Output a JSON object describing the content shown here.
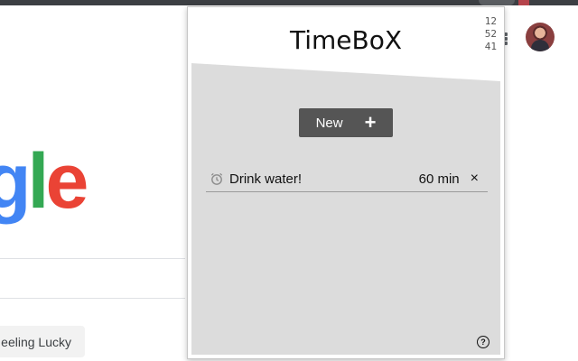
{
  "background": {
    "lucky_button_label": "eeling Lucky",
    "google_partial": {
      "g": "g",
      "l": "l",
      "e": "e"
    },
    "colors": {
      "blue": "#4285f4",
      "green": "#34a853",
      "red": "#ea4335"
    }
  },
  "popup": {
    "title": "TimeBoX",
    "clock": {
      "hours": "12",
      "minutes": "52",
      "seconds": "41"
    },
    "new_button_label": "New",
    "new_button_icon": "+",
    "tasks": [
      {
        "label": "Drink water!",
        "duration": "60 min",
        "icon": "alarm-clock-icon"
      }
    ],
    "remove_icon": "×",
    "help_icon": "?"
  },
  "colors": {
    "panel": "#dcdcdc",
    "button": "#555555"
  }
}
